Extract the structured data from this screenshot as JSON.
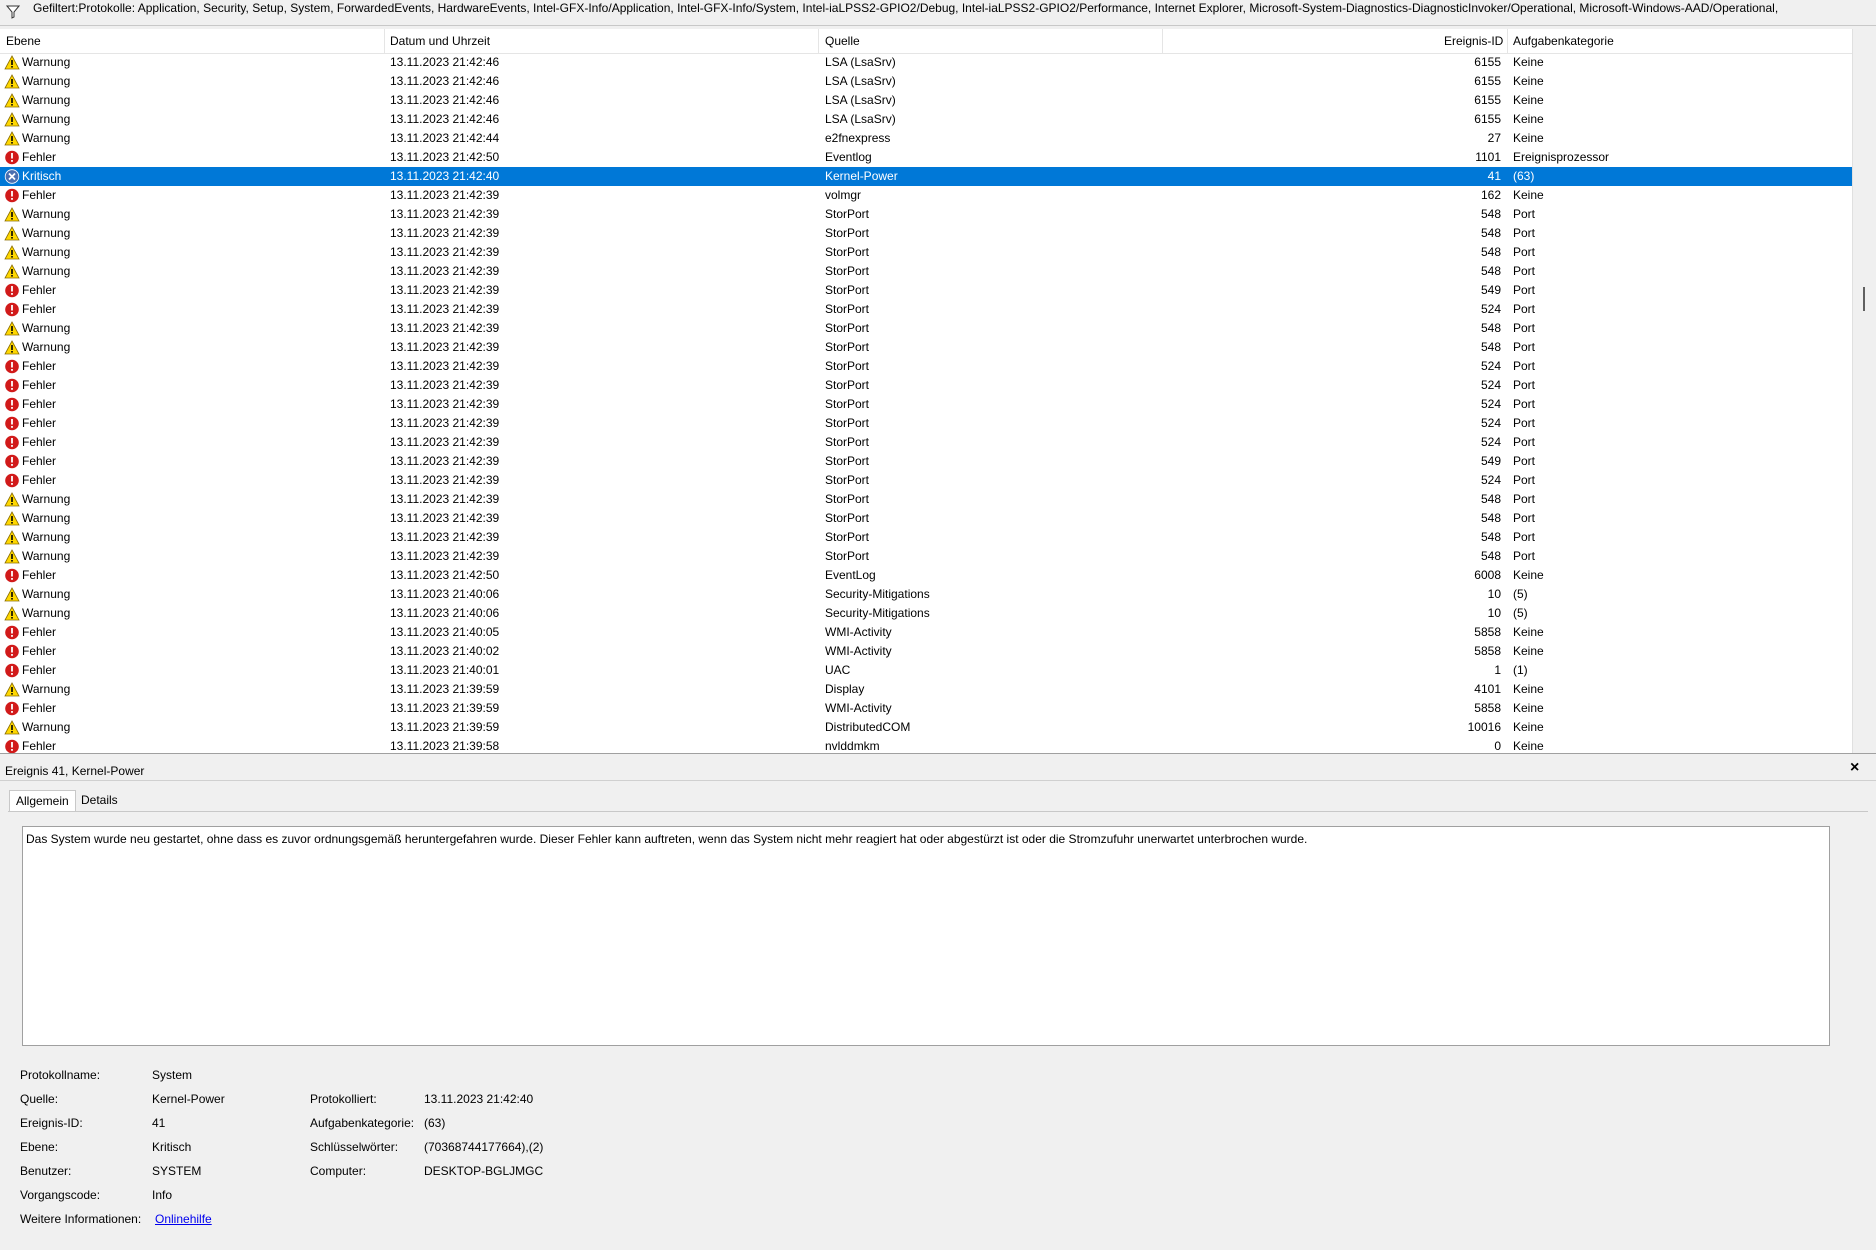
{
  "filter_text": "Gefiltert:Protokolle: Application, Security, Setup, System, ForwardedEvents, HardwareEvents, Intel-GFX-Info/Application, Intel-GFX-Info/System, Intel-iaLPSS2-GPIO2/Debug, Intel-iaLPSS2-GPIO2/Performance, Internet Explorer, Microsoft-System-Diagnostics-DiagnosticInvoker/Operational, Microsoft-Windows-AAD/Operational,",
  "columns": {
    "level": "Ebene",
    "datetime": "Datum und Uhrzeit",
    "source": "Quelle",
    "event_id": "Ereignis-ID",
    "category": "Aufgabenkategorie"
  },
  "rows": [
    {
      "level": "Warnung",
      "datetime": "13.11.2023 21:42:46",
      "source": "LSA (LsaSrv)",
      "event_id": "6155",
      "category": "Keine"
    },
    {
      "level": "Warnung",
      "datetime": "13.11.2023 21:42:46",
      "source": "LSA (LsaSrv)",
      "event_id": "6155",
      "category": "Keine"
    },
    {
      "level": "Warnung",
      "datetime": "13.11.2023 21:42:46",
      "source": "LSA (LsaSrv)",
      "event_id": "6155",
      "category": "Keine"
    },
    {
      "level": "Warnung",
      "datetime": "13.11.2023 21:42:46",
      "source": "LSA (LsaSrv)",
      "event_id": "6155",
      "category": "Keine"
    },
    {
      "level": "Warnung",
      "datetime": "13.11.2023 21:42:44",
      "source": "e2fnexpress",
      "event_id": "27",
      "category": "Keine"
    },
    {
      "level": "Fehler",
      "datetime": "13.11.2023 21:42:50",
      "source": "Eventlog",
      "event_id": "1101",
      "category": "Ereignisprozessor"
    },
    {
      "level": "Kritisch",
      "datetime": "13.11.2023 21:42:40",
      "source": "Kernel-Power",
      "event_id": "41",
      "category": "(63)",
      "selected": true
    },
    {
      "level": "Fehler",
      "datetime": "13.11.2023 21:42:39",
      "source": "volmgr",
      "event_id": "162",
      "category": "Keine"
    },
    {
      "level": "Warnung",
      "datetime": "13.11.2023 21:42:39",
      "source": "StorPort",
      "event_id": "548",
      "category": "Port"
    },
    {
      "level": "Warnung",
      "datetime": "13.11.2023 21:42:39",
      "source": "StorPort",
      "event_id": "548",
      "category": "Port"
    },
    {
      "level": "Warnung",
      "datetime": "13.11.2023 21:42:39",
      "source": "StorPort",
      "event_id": "548",
      "category": "Port"
    },
    {
      "level": "Warnung",
      "datetime": "13.11.2023 21:42:39",
      "source": "StorPort",
      "event_id": "548",
      "category": "Port"
    },
    {
      "level": "Fehler",
      "datetime": "13.11.2023 21:42:39",
      "source": "StorPort",
      "event_id": "549",
      "category": "Port"
    },
    {
      "level": "Fehler",
      "datetime": "13.11.2023 21:42:39",
      "source": "StorPort",
      "event_id": "524",
      "category": "Port"
    },
    {
      "level": "Warnung",
      "datetime": "13.11.2023 21:42:39",
      "source": "StorPort",
      "event_id": "548",
      "category": "Port"
    },
    {
      "level": "Warnung",
      "datetime": "13.11.2023 21:42:39",
      "source": "StorPort",
      "event_id": "548",
      "category": "Port"
    },
    {
      "level": "Fehler",
      "datetime": "13.11.2023 21:42:39",
      "source": "StorPort",
      "event_id": "524",
      "category": "Port"
    },
    {
      "level": "Fehler",
      "datetime": "13.11.2023 21:42:39",
      "source": "StorPort",
      "event_id": "524",
      "category": "Port"
    },
    {
      "level": "Fehler",
      "datetime": "13.11.2023 21:42:39",
      "source": "StorPort",
      "event_id": "524",
      "category": "Port"
    },
    {
      "level": "Fehler",
      "datetime": "13.11.2023 21:42:39",
      "source": "StorPort",
      "event_id": "524",
      "category": "Port"
    },
    {
      "level": "Fehler",
      "datetime": "13.11.2023 21:42:39",
      "source": "StorPort",
      "event_id": "524",
      "category": "Port"
    },
    {
      "level": "Fehler",
      "datetime": "13.11.2023 21:42:39",
      "source": "StorPort",
      "event_id": "549",
      "category": "Port"
    },
    {
      "level": "Fehler",
      "datetime": "13.11.2023 21:42:39",
      "source": "StorPort",
      "event_id": "524",
      "category": "Port"
    },
    {
      "level": "Warnung",
      "datetime": "13.11.2023 21:42:39",
      "source": "StorPort",
      "event_id": "548",
      "category": "Port"
    },
    {
      "level": "Warnung",
      "datetime": "13.11.2023 21:42:39",
      "source": "StorPort",
      "event_id": "548",
      "category": "Port"
    },
    {
      "level": "Warnung",
      "datetime": "13.11.2023 21:42:39",
      "source": "StorPort",
      "event_id": "548",
      "category": "Port"
    },
    {
      "level": "Warnung",
      "datetime": "13.11.2023 21:42:39",
      "source": "StorPort",
      "event_id": "548",
      "category": "Port"
    },
    {
      "level": "Fehler",
      "datetime": "13.11.2023 21:42:50",
      "source": "EventLog",
      "event_id": "6008",
      "category": "Keine"
    },
    {
      "level": "Warnung",
      "datetime": "13.11.2023 21:40:06",
      "source": "Security-Mitigations",
      "event_id": "10",
      "category": "(5)"
    },
    {
      "level": "Warnung",
      "datetime": "13.11.2023 21:40:06",
      "source": "Security-Mitigations",
      "event_id": "10",
      "category": "(5)"
    },
    {
      "level": "Fehler",
      "datetime": "13.11.2023 21:40:05",
      "source": "WMI-Activity",
      "event_id": "5858",
      "category": "Keine"
    },
    {
      "level": "Fehler",
      "datetime": "13.11.2023 21:40:02",
      "source": "WMI-Activity",
      "event_id": "5858",
      "category": "Keine"
    },
    {
      "level": "Fehler",
      "datetime": "13.11.2023 21:40:01",
      "source": "UAC",
      "event_id": "1",
      "category": "(1)"
    },
    {
      "level": "Warnung",
      "datetime": "13.11.2023 21:39:59",
      "source": "Display",
      "event_id": "4101",
      "category": "Keine"
    },
    {
      "level": "Fehler",
      "datetime": "13.11.2023 21:39:59",
      "source": "WMI-Activity",
      "event_id": "5858",
      "category": "Keine"
    },
    {
      "level": "Warnung",
      "datetime": "13.11.2023 21:39:59",
      "source": "DistributedCOM",
      "event_id": "10016",
      "category": "Keine"
    },
    {
      "level": "Fehler",
      "datetime": "13.11.2023 21:39:58",
      "source": "nvlddmkm",
      "event_id": "0",
      "category": "Keine"
    }
  ],
  "detail": {
    "title": "Ereignis 41, Kernel-Power",
    "close": "×",
    "tabs": [
      "Allgemein",
      "Details"
    ],
    "description": "Das System wurde neu gestartet, ohne dass es zuvor ordnungsgemäß heruntergefahren wurde. Dieser Fehler kann auftreten, wenn das System nicht mehr reagiert hat oder abgestürzt ist oder die Stromzufuhr unerwartet unterbrochen wurde.",
    "labels": {
      "log_name": "Protokollname:",
      "source": "Quelle:",
      "event_id": "Ereignis-ID:",
      "level": "Ebene:",
      "user": "Benutzer:",
      "opcode": "Vorgangscode:",
      "more_info": "Weitere Informationen:",
      "logged": "Protokolliert:",
      "category": "Aufgabenkategorie:",
      "keywords": "Schlüsselwörter:",
      "computer": "Computer:"
    },
    "values": {
      "log_name": "System",
      "source": "Kernel-Power",
      "event_id": "41",
      "level": "Kritisch",
      "user": "SYSTEM",
      "opcode": "Info",
      "more_info": "Onlinehilfe",
      "logged": "13.11.2023 21:42:40",
      "category": "(63)",
      "keywords": "(70368744177664),(2)",
      "computer": "DESKTOP-BGLJMGC"
    }
  },
  "colors": {
    "selected": "#0078d7",
    "warning": "#ffd800",
    "error": "#d11a1a",
    "critical": "#4a6fb0"
  }
}
